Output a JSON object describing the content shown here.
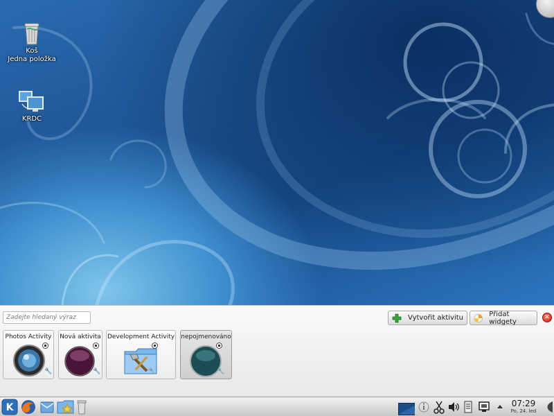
{
  "desktop": {
    "icons": [
      {
        "label": "Koš",
        "sublabel": "Jedna položka",
        "icon": "trash-icon"
      },
      {
        "label": "KRDC",
        "icon": "remote-desktop-icon"
      }
    ]
  },
  "activity_manager": {
    "search_placeholder": "Zadejte hledaný výraz",
    "create_activity_label": "Vytvořit aktivitu",
    "add_widgets_label": "Přidat widgety",
    "activities": [
      {
        "title": "Photos Activity",
        "icon": "camera-lens-icon"
      },
      {
        "title": "Nová aktivita",
        "icon": "purple-orb-icon"
      },
      {
        "title": "Development Activity",
        "icon": "folder-tools-icon"
      },
      {
        "title": "nepojmenováno",
        "icon": "teal-orb-icon",
        "active": true
      }
    ]
  },
  "taskbar": {
    "clock_time": "07:29",
    "clock_date": "Po, 24. led",
    "launchers": [
      "kde-menu-icon",
      "firefox-icon",
      "mail-icon",
      "folder-star-icon",
      "trash-can-icon"
    ],
    "tray": [
      "pager-icon",
      "info-icon",
      "klipper-scissors-icon",
      "volume-icon",
      "clipboard-icon",
      "network-icon",
      "expand-arrow-icon"
    ]
  },
  "colors": {
    "wallpaper_dark": "#0e3b73",
    "wallpaper_light": "#7fc6ec",
    "close_red": "#d01c0c",
    "add_green": "#2f9e2f"
  }
}
